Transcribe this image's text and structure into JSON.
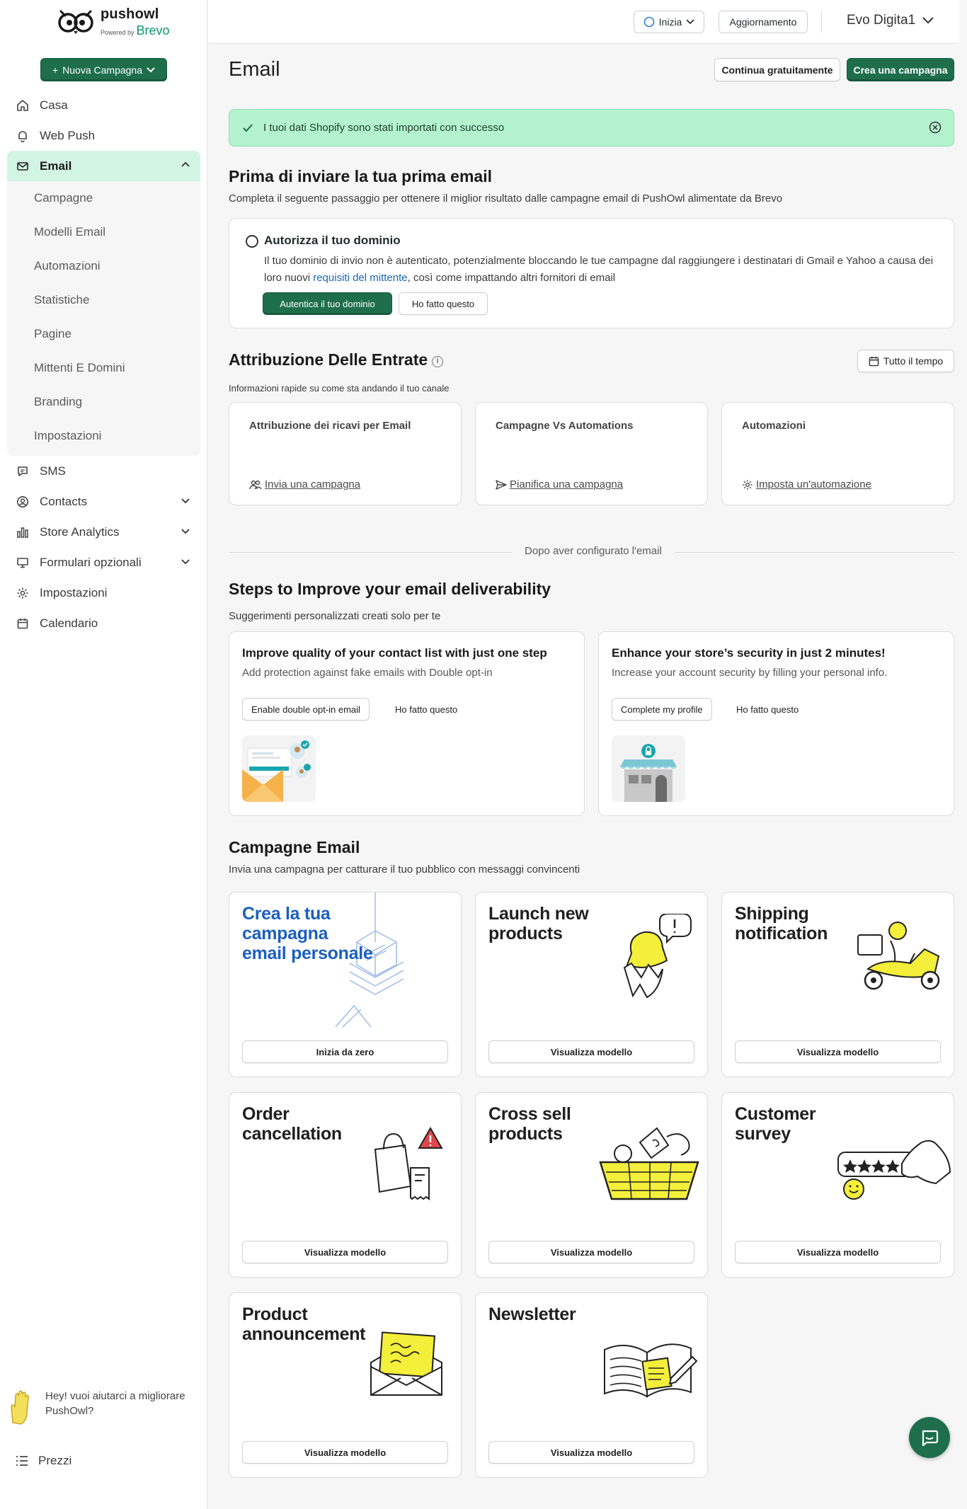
{
  "brand": {
    "name": "pushowl",
    "powered_by": "Powered by",
    "partner": "Brevo"
  },
  "sidebar": {
    "new_campaign": "Nuova Campagna",
    "items": [
      {
        "label": "Casa",
        "icon": "home-icon"
      },
      {
        "label": "Web Push",
        "icon": "bell-icon"
      },
      {
        "label": "Email",
        "icon": "mail-icon"
      },
      {
        "label": "SMS",
        "icon": "chat-icon"
      },
      {
        "label": "Contacts",
        "icon": "user-circle-icon"
      },
      {
        "label": "Store Analytics",
        "icon": "bar-chart-icon"
      },
      {
        "label": "Formulari opzionali",
        "icon": "monitor-icon"
      },
      {
        "label": "Impostazioni",
        "icon": "gear-icon"
      },
      {
        "label": "Calendario",
        "icon": "calendar-icon"
      }
    ],
    "email_sub": [
      "Campagne",
      "Modelli Email",
      "Automazioni",
      "Statistiche",
      "Pagine",
      "Mittenti E Domini",
      "Branding",
      "Impostazioni"
    ],
    "help_text": "Hey! vuoi aiutarci a migliorare PushOwl?",
    "pricing": "Prezzi"
  },
  "topbar": {
    "start": "Inizia",
    "upgrade": "Aggiornamento",
    "account": "Evo Digita1"
  },
  "page": {
    "title": "Email",
    "continue_free": "Continua gratuitamente",
    "create_campaign": "Crea una campagna",
    "banner": "I tuoi dati Shopify sono stati importati con successo"
  },
  "first_email": {
    "title": "Prima di inviare la tua prima email",
    "subtitle": "Completa il seguente passaggio per ottenere il miglior risultato dalle campagne email di PushOwl alimentate da Brevo",
    "card_title": "Autorizza il tuo dominio",
    "desc_1": "Il tuo dominio di invio non è autenticato, potenzialmente bloccando le tue campagne dal raggiungere i destinatari di Gmail e Yahoo a causa dei loro nuovi ",
    "desc_link": "requisiti del mittente",
    "desc_2": ", così come impattando altri fornitori di email",
    "auth_button": "Autentica il tuo dominio",
    "done_button": "Ho fatto questo"
  },
  "revenue": {
    "title": "Attribuzione Delle Entrate",
    "subtitle": "Informazioni rapide su come sta andando il tuo canale",
    "range": "Tutto il tempo",
    "cards": [
      {
        "title": "Attribuzione dei ricavi per Email",
        "link": "Invia una campagna",
        "icon": "users-icon"
      },
      {
        "title": "Campagne Vs Automations",
        "link": "Pianifica una campagna",
        "icon": "send-icon"
      },
      {
        "title": "Automazioni",
        "link": "Imposta un'automazione",
        "icon": "gear-icon"
      }
    ]
  },
  "divider": "Dopo aver configurato l'email",
  "deliverability": {
    "title": "Steps to Improve your email deliverability",
    "subtitle": "Suggerimenti personalizzati creati solo per te",
    "tips": [
      {
        "title": "Improve quality of your contact list with just one step",
        "desc": "Add protection against fake emails with Double opt-in",
        "action": "Enable double opt-in email",
        "done": "Ho fatto questo"
      },
      {
        "title": "Enhance your store’s security in just 2 minutes!",
        "desc": "Increase your account security by filling your personal info.",
        "action": "Complete my profile",
        "done": "Ho fatto questo"
      }
    ]
  },
  "campaigns": {
    "title": "Campagne Email",
    "subtitle": "Invia una campagna per catturare il tuo pubblico con messaggi convincenti",
    "templates": [
      {
        "title": "Crea la tua campagna email personale",
        "button": "Inizia da zero"
      },
      {
        "title": "Launch new products",
        "button": "Visualizza modello"
      },
      {
        "title": "Shipping notification",
        "button": "Visualizza modello"
      },
      {
        "title": "Order cancellation",
        "button": "Visualizza modello"
      },
      {
        "title": "Cross sell products",
        "button": "Visualizza modello"
      },
      {
        "title": "Customer survey",
        "button": "Visualizza modello"
      },
      {
        "title": "Product announcement",
        "button": "Visualizza modello"
      },
      {
        "title": "Newsletter",
        "button": "Visualizza modello"
      }
    ]
  },
  "colors": {
    "brand_green": "#1e6e4c",
    "success_bg": "#b3f4cf",
    "active_nav": "#d3f5e3",
    "accent_yellow": "#f4ef3a",
    "link_blue": "#1769b4"
  }
}
